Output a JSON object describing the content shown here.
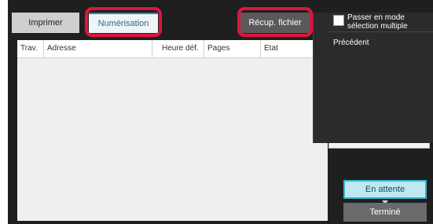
{
  "tabs": {
    "print": "Imprimer",
    "scan": "Numérisation",
    "file": "Récup. fichier"
  },
  "table": {
    "headers": [
      "Trav.",
      "Adresse",
      "Heure déf.",
      "Pages",
      "Etat"
    ]
  },
  "menu": {
    "multi_select_label": "Passer en mode sélection multiple",
    "previous": "Précédent"
  },
  "buttons": {
    "waiting": "En attente",
    "done": "Terminé"
  },
  "colors": {
    "highlight": "#e0143c",
    "active_tab_accent": "#2a88a8",
    "waiting_button": "#37b4cf"
  }
}
